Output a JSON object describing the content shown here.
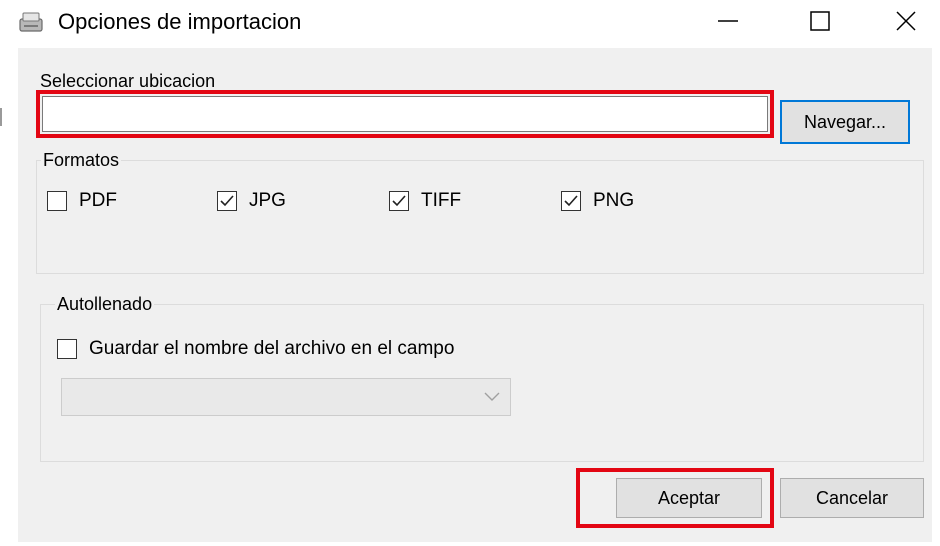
{
  "window": {
    "title": "Opciones de importacion",
    "icon": "scanner-icon",
    "controls": [
      "minimize-icon",
      "maximize-icon",
      "close-icon"
    ]
  },
  "location": {
    "label": "Seleccionar ubicacion",
    "path_value": "",
    "browse_label": "Navegar..."
  },
  "formats": {
    "legend": "Formatos",
    "options": [
      {
        "label": "PDF",
        "checked": false
      },
      {
        "label": "JPG",
        "checked": true
      },
      {
        "label": "TIFF",
        "checked": true
      },
      {
        "label": "PNG",
        "checked": true
      }
    ]
  },
  "autofill": {
    "legend": "Autollenado",
    "save_label": "Guardar el nombre del archivo en el campo",
    "save_checked": false,
    "field_value": "",
    "field_enabled": false
  },
  "actions": {
    "accept_label": "Aceptar",
    "cancel_label": "Cancelar"
  },
  "colors": {
    "highlight": "#e30613",
    "focus": "#0078d7",
    "client_bg": "#f0f0f0"
  }
}
